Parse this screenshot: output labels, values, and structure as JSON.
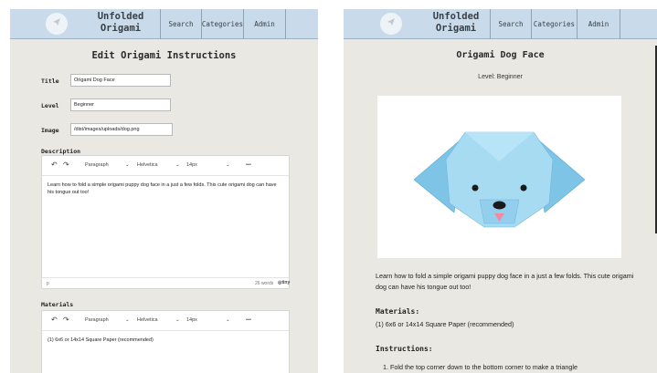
{
  "nav": {
    "brand_line1": "Unfolded",
    "brand_line2": "Origami",
    "search": "Search",
    "categories": "Categories",
    "admin": "Admin"
  },
  "edit": {
    "page_title": "Edit Origami Instructions",
    "title_label": "Title",
    "title_value": "Origami Dog Face",
    "level_label": "Level",
    "level_value": "Beginner",
    "image_label": "Image",
    "image_value": "/dist/images/uploads/dog.png",
    "description_label": "Description",
    "description_text": "Learn how to fold a simple origami puppy dog face in a just a few folds. This cute origami dog can have his tongue out too!",
    "materials_label": "Materials",
    "materials_text": "(1) 6x6 or 14x14 Square Paper (recommended)",
    "toolbar": {
      "block_format": "Paragraph",
      "font_family": "Helvetica",
      "font_size": "14px",
      "more": "•••"
    },
    "status_path": "p",
    "word_count": "26 words",
    "brand": "tiny"
  },
  "view": {
    "title": "Origami Dog Face",
    "level": "Level: Beginner",
    "description": "Learn how to fold a simple origami puppy dog face in a just a few folds. This cute origami dog can have his tongue out too!",
    "materials_heading": "Materials:",
    "materials_text": "(1) 6x6 or 14x14 Square Paper (recommended)",
    "instructions_heading": "Instructions:",
    "instruction_1": "1. Fold the top corner down to the bottom corner to make a triangle"
  },
  "colors": {
    "panel_bg": "#eae8e3",
    "nav_bg": "#c9dbea",
    "dog_blue": "#9ed3ec"
  }
}
